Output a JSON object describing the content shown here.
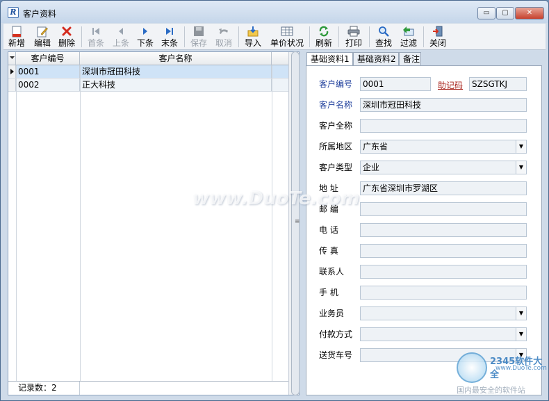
{
  "window": {
    "title": "客户资料",
    "controls": {
      "minimize": "▭",
      "maximize": "▢",
      "close": "✕"
    }
  },
  "toolbar": {
    "buttons": [
      {
        "label": "新增",
        "icon": "new-doc-icon",
        "enabled": true
      },
      {
        "label": "编辑",
        "icon": "edit-icon",
        "enabled": true
      },
      {
        "label": "删除",
        "icon": "delete-x-icon",
        "enabled": true
      },
      {
        "label": "首条",
        "icon": "first-record-icon",
        "enabled": false
      },
      {
        "label": "上条",
        "icon": "prev-record-icon",
        "enabled": false
      },
      {
        "label": "下条",
        "icon": "next-record-icon",
        "enabled": true
      },
      {
        "label": "末条",
        "icon": "last-record-icon",
        "enabled": true
      },
      {
        "label": "保存",
        "icon": "save-icon",
        "enabled": false
      },
      {
        "label": "取消",
        "icon": "undo-icon",
        "enabled": false
      },
      {
        "label": "导入",
        "icon": "import-icon",
        "enabled": true
      },
      {
        "label": "单价状况",
        "icon": "price-table-icon",
        "enabled": true
      },
      {
        "label": "刷新",
        "icon": "refresh-icon",
        "enabled": true
      },
      {
        "label": "打印",
        "icon": "printer-icon",
        "enabled": true
      },
      {
        "label": "查找",
        "icon": "magnifier-icon",
        "enabled": true
      },
      {
        "label": "过滤",
        "icon": "filter-icon",
        "enabled": true
      },
      {
        "label": "关闭",
        "icon": "exit-door-icon",
        "enabled": true
      }
    ]
  },
  "grid": {
    "columns": [
      "客户编号",
      "客户名称"
    ],
    "rows": [
      {
        "code": "0001",
        "name": "深圳市冠田科技",
        "selected": true
      },
      {
        "code": "0002",
        "name": "正大科技",
        "selected": false
      }
    ],
    "footer": "记录数：2"
  },
  "tabs": [
    "基础资料1",
    "基础资料2",
    "备注"
  ],
  "form": {
    "customer_code_label": "客户编号",
    "customer_code": "0001",
    "mnemonic_link": "助记码",
    "mnemonic": "SZSGTKJ",
    "customer_name_label": "客户名称",
    "customer_name": "深圳市冠田科技",
    "full_name_label": "客户全称",
    "full_name": "",
    "region_label": "所属地区",
    "region": "广东省",
    "type_label": "客户类型",
    "type": "企业",
    "address_label": "地 址",
    "address": "广东省深圳市罗湖区",
    "postcode_label": "邮 编",
    "postcode": "",
    "phone_label": "电 话",
    "phone": "",
    "fax_label": "传 真",
    "fax": "",
    "contact_label": "联系人",
    "contact": "",
    "mobile_label": "手 机",
    "mobile": "",
    "salesman_label": "业务员",
    "salesman": "",
    "payment_label": "付款方式",
    "payment": "",
    "plate_label": "送货车号",
    "plate": ""
  },
  "watermark": {
    "text": "www.DuoTe.com",
    "badge_main": "2345软件大全",
    "badge_url": "www.DuoTe.com",
    "badge_sub": "国内最安全的软件站"
  },
  "colors": {
    "selection": "#cfe3f7",
    "label_blue": "#1f3f9c",
    "link_red": "#a8221a",
    "delete_red": "#d42b1e"
  }
}
